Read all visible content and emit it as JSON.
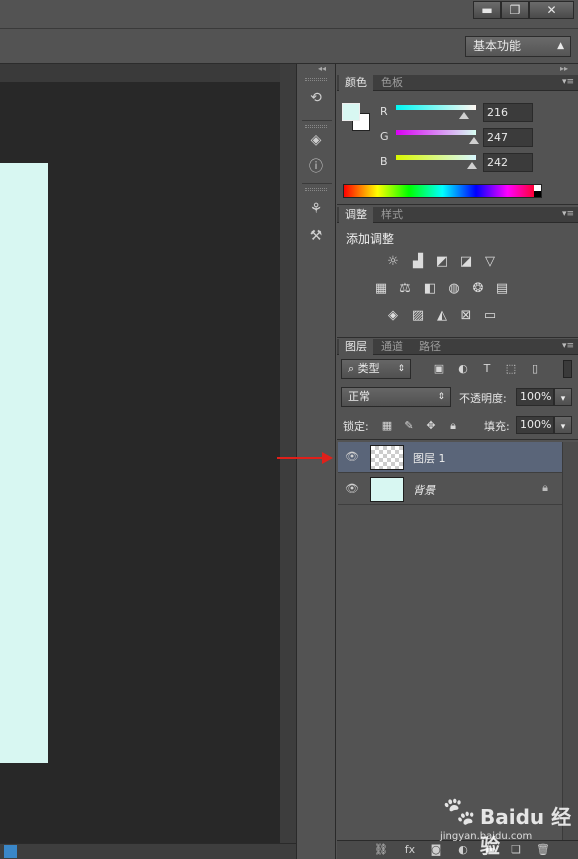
{
  "window": {
    "minimize_icon": "minimize-icon",
    "restore_icon": "restore-icon",
    "close_icon": "close-icon",
    "minimize": "▬",
    "restore": "❐",
    "close": "✕"
  },
  "options_bar": {
    "workspace": "基本功能"
  },
  "color_panel": {
    "tabs": [
      "颜色",
      "色板"
    ],
    "foreground_color": "#d8f7f2",
    "background_color": "#ffffff",
    "channels": [
      {
        "label": "R",
        "value": "216",
        "fraction": 0.847
      },
      {
        "label": "G",
        "value": "247",
        "fraction": 0.969
      },
      {
        "label": "B",
        "value": "242",
        "fraction": 0.949
      }
    ]
  },
  "adjustments_panel": {
    "tabs": [
      "调整",
      "样式"
    ],
    "title": "添加调整",
    "row1_icons": [
      "brightness-icon",
      "levels-icon",
      "curves-icon",
      "exposure-icon",
      "vibrance-icon"
    ],
    "row2_icons": [
      "hue-saturation-icon",
      "color-balance-icon",
      "black-white-icon",
      "photo-filter-icon",
      "channel-mixer-icon",
      "color-lookup-icon"
    ],
    "row3_icons": [
      "invert-icon",
      "posterize-icon",
      "threshold-icon",
      "selective-color-icon",
      "gradient-map-icon"
    ]
  },
  "layers_panel": {
    "tabs": [
      "图层",
      "通道",
      "路径"
    ],
    "filter_type": "类型",
    "blend_mode": "正常",
    "opacity_label": "不透明度:",
    "opacity_value": "100%",
    "lock_label": "锁定:",
    "fill_label": "填充:",
    "fill_value": "100%",
    "layers": [
      {
        "name": "图层 1",
        "selected": true,
        "transparent": true
      },
      {
        "name": "背景",
        "selected": false,
        "locked": true
      }
    ]
  },
  "watermark": {
    "brand": "Baidu 经验",
    "url": "jingyan.baidu.com"
  }
}
